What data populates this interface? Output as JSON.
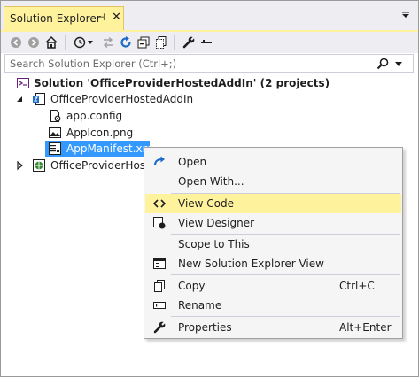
{
  "window": {
    "tab_title": "Solution Explorer",
    "pin_glyph": "⊣",
    "close_glyph": "✕",
    "accent": "#FFF29D"
  },
  "toolbar": {
    "buttons": [
      "back-icon",
      "forward-icon",
      "home-icon",
      "history-icon",
      "sync-icon",
      "refresh-icon",
      "collapse-all-icon",
      "show-all-files-icon",
      "properties-wrench-icon",
      "preview-icon"
    ]
  },
  "search": {
    "placeholder": "Search Solution Explorer (Ctrl+;)"
  },
  "tree": {
    "solution": "Solution 'OfficeProviderHostedAddIn' (2 projects)",
    "project1": "OfficeProviderHostedAddIn",
    "file_app_config": "app.config",
    "file_app_icon": "AppIcon.png",
    "file_app_manifest": "AppManifest.xml",
    "project2": "OfficeProviderHostedAddInWeb",
    "selection_color": "#3399FF"
  },
  "context_menu": {
    "open": "Open",
    "open_with": "Open With...",
    "view_code": "View Code",
    "view_designer": "View Designer",
    "scope_to_this": "Scope to This",
    "new_view": "New Solution Explorer View",
    "copy": "Copy",
    "copy_shortcut": "Ctrl+C",
    "rename": "Rename",
    "properties": "Properties",
    "properties_shortcut": "Alt+Enter"
  }
}
